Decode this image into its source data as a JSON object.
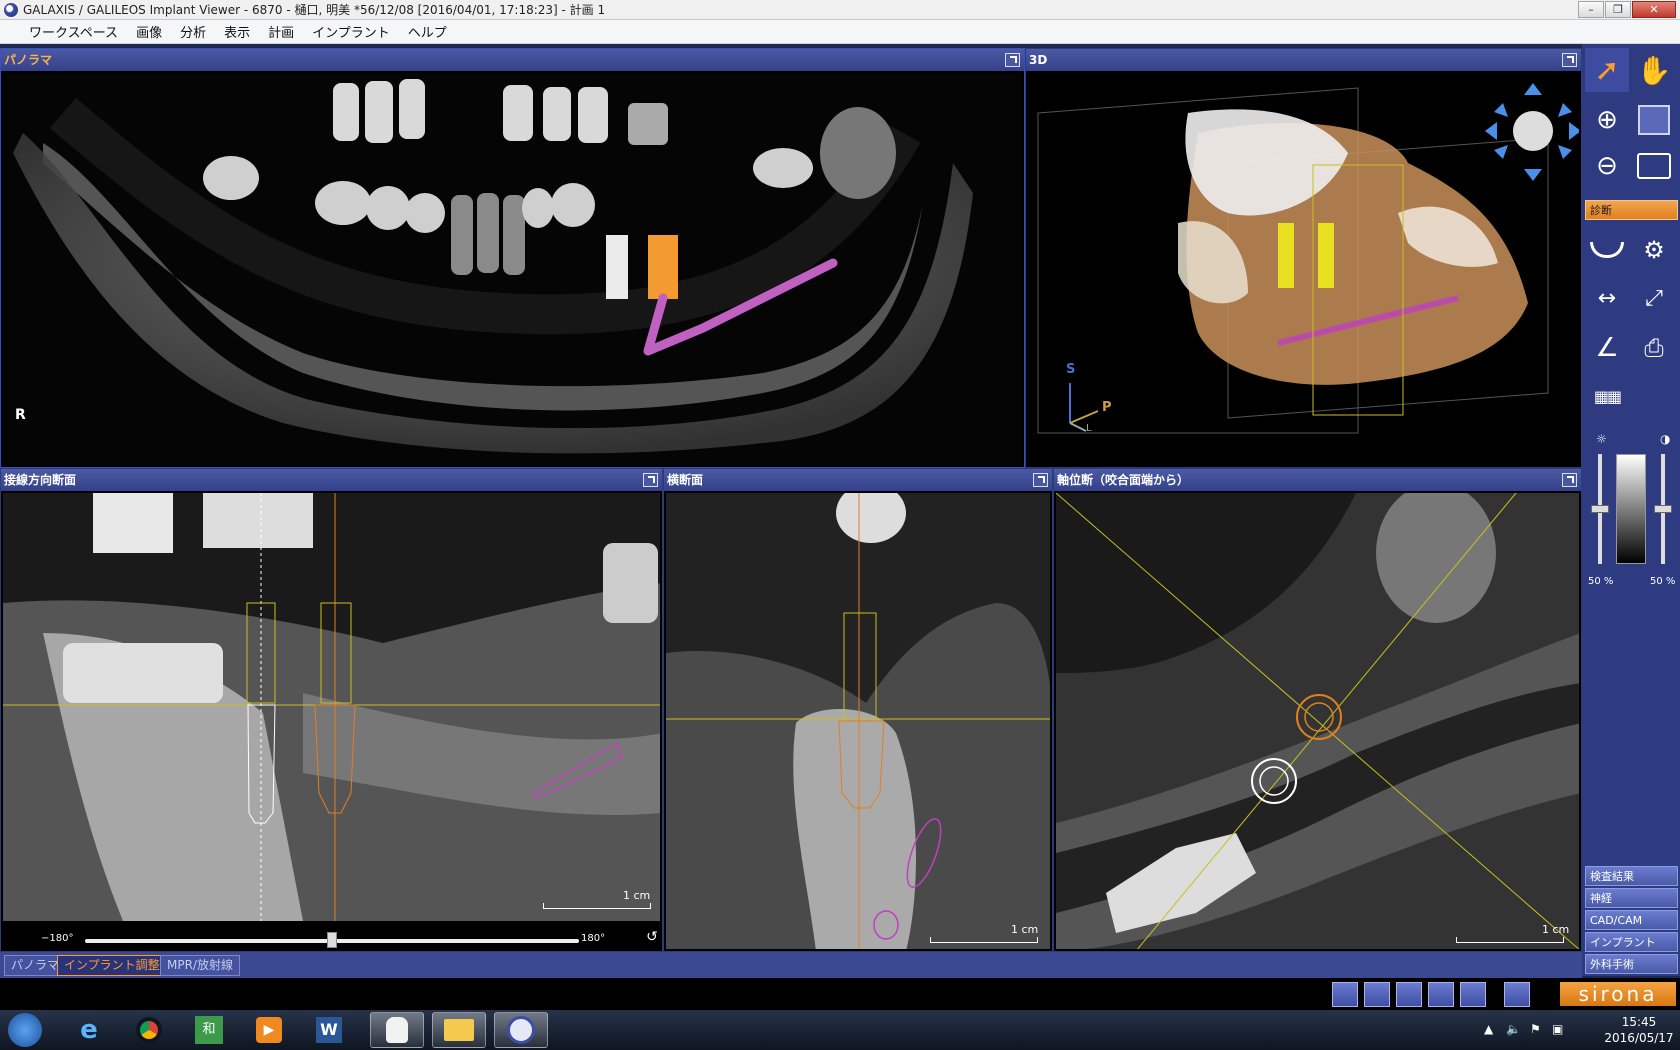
{
  "window": {
    "title": "GALAXIS / GALILEOS Implant Viewer - 6870 - 樋口, 明美 *56/12/08 [2016/04/01, 17:18:23] - 計画 1"
  },
  "menu": [
    "ワークスペース",
    "画像",
    "分析",
    "表示",
    "計画",
    "インプラント",
    "ヘルプ"
  ],
  "panels": {
    "panorama": {
      "title": "パノラマ",
      "marker": "R"
    },
    "view3d": {
      "title": "3D",
      "axis_s": "S",
      "axis_p": "P",
      "axis_l": "L"
    },
    "tangential": {
      "title": "接線方向断面",
      "scale": "1 cm",
      "slider_min": "−180°",
      "slider_max": "180°",
      "slider_value": 0.5
    },
    "cross": {
      "title": "横断面",
      "scale": "1 cm"
    },
    "axial": {
      "title": "軸位断（咬合面端から）",
      "scale": "1 cm"
    }
  },
  "toolbar": {
    "diagnosis_label": "診断",
    "brightness_left": "50 %",
    "brightness_right": "50 %",
    "brightness_left_level": 0.5,
    "brightness_right_level": 0.5,
    "bottom_labels": [
      "検査結果",
      "神経",
      "CAD/CAM",
      "インプラント",
      "外科手術"
    ]
  },
  "tabs": [
    "パノラマ",
    "インプラント調整",
    "MPR/放射線"
  ],
  "active_tab": 1,
  "brand": "sirona",
  "clock": {
    "time": "15:45",
    "date": "2016/05/17"
  },
  "colors": {
    "accent_orange": "#ff9a33",
    "panel_blue": "#34418a",
    "nerve_purple": "#c040c0",
    "implant_yellow": "#e8e020"
  }
}
